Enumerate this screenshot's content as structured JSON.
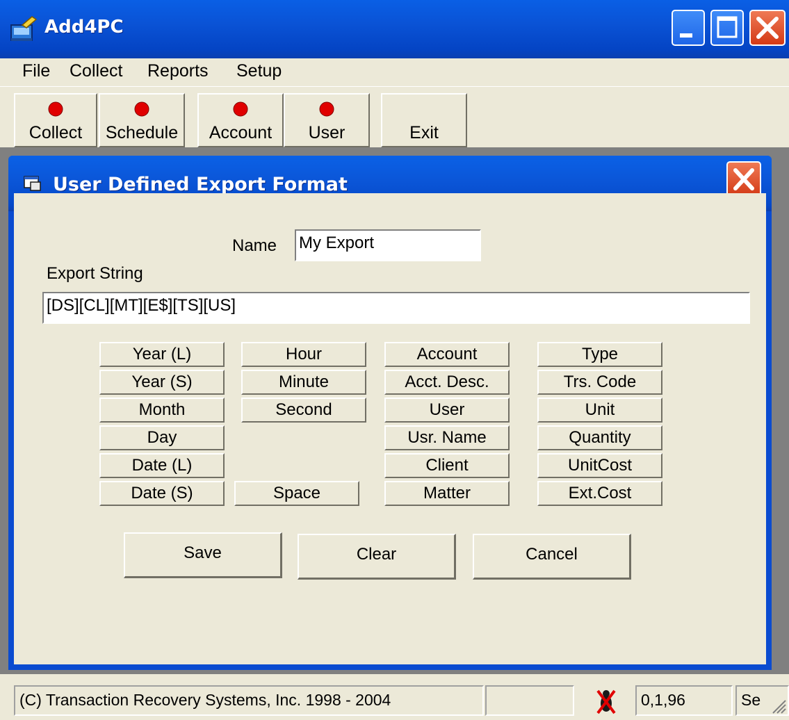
{
  "window": {
    "title": "Add4PC"
  },
  "menu": [
    "File",
    "Collect",
    "Reports",
    "Setup"
  ],
  "toolbar": {
    "collect": "Collect",
    "schedule": "Schedule",
    "account": "Account",
    "user": "User",
    "exit": "Exit",
    "indicator_color": "#e00000"
  },
  "dialog": {
    "title": "User Defined Export Format",
    "name_label": "Name",
    "name_value": "My Export",
    "export_string_label": "Export String",
    "export_string_value": "[DS][CL][MT][E$][TS][US]",
    "tokens": {
      "col1": [
        "Year (L)",
        "Year (S)",
        "Month",
        "Day",
        "Date (L)",
        "Date (S)"
      ],
      "col2": [
        "Hour",
        "Minute",
        "Second"
      ],
      "space": "Space",
      "col3": [
        "Account",
        "Acct. Desc.",
        "User",
        "Usr. Name",
        "Client",
        "Matter"
      ],
      "col4": [
        "Type",
        "Trs. Code",
        "Unit",
        "Quantity",
        "UnitCost",
        "Ext.Cost"
      ]
    },
    "buttons": {
      "save": "Save",
      "clear": "Clear",
      "cancel": "Cancel"
    }
  },
  "statusbar": {
    "copyright": "(C) Transaction Recovery Systems, Inc. 1998 - 2004",
    "empty": "",
    "version": "0,1,96",
    "last": "Se"
  }
}
